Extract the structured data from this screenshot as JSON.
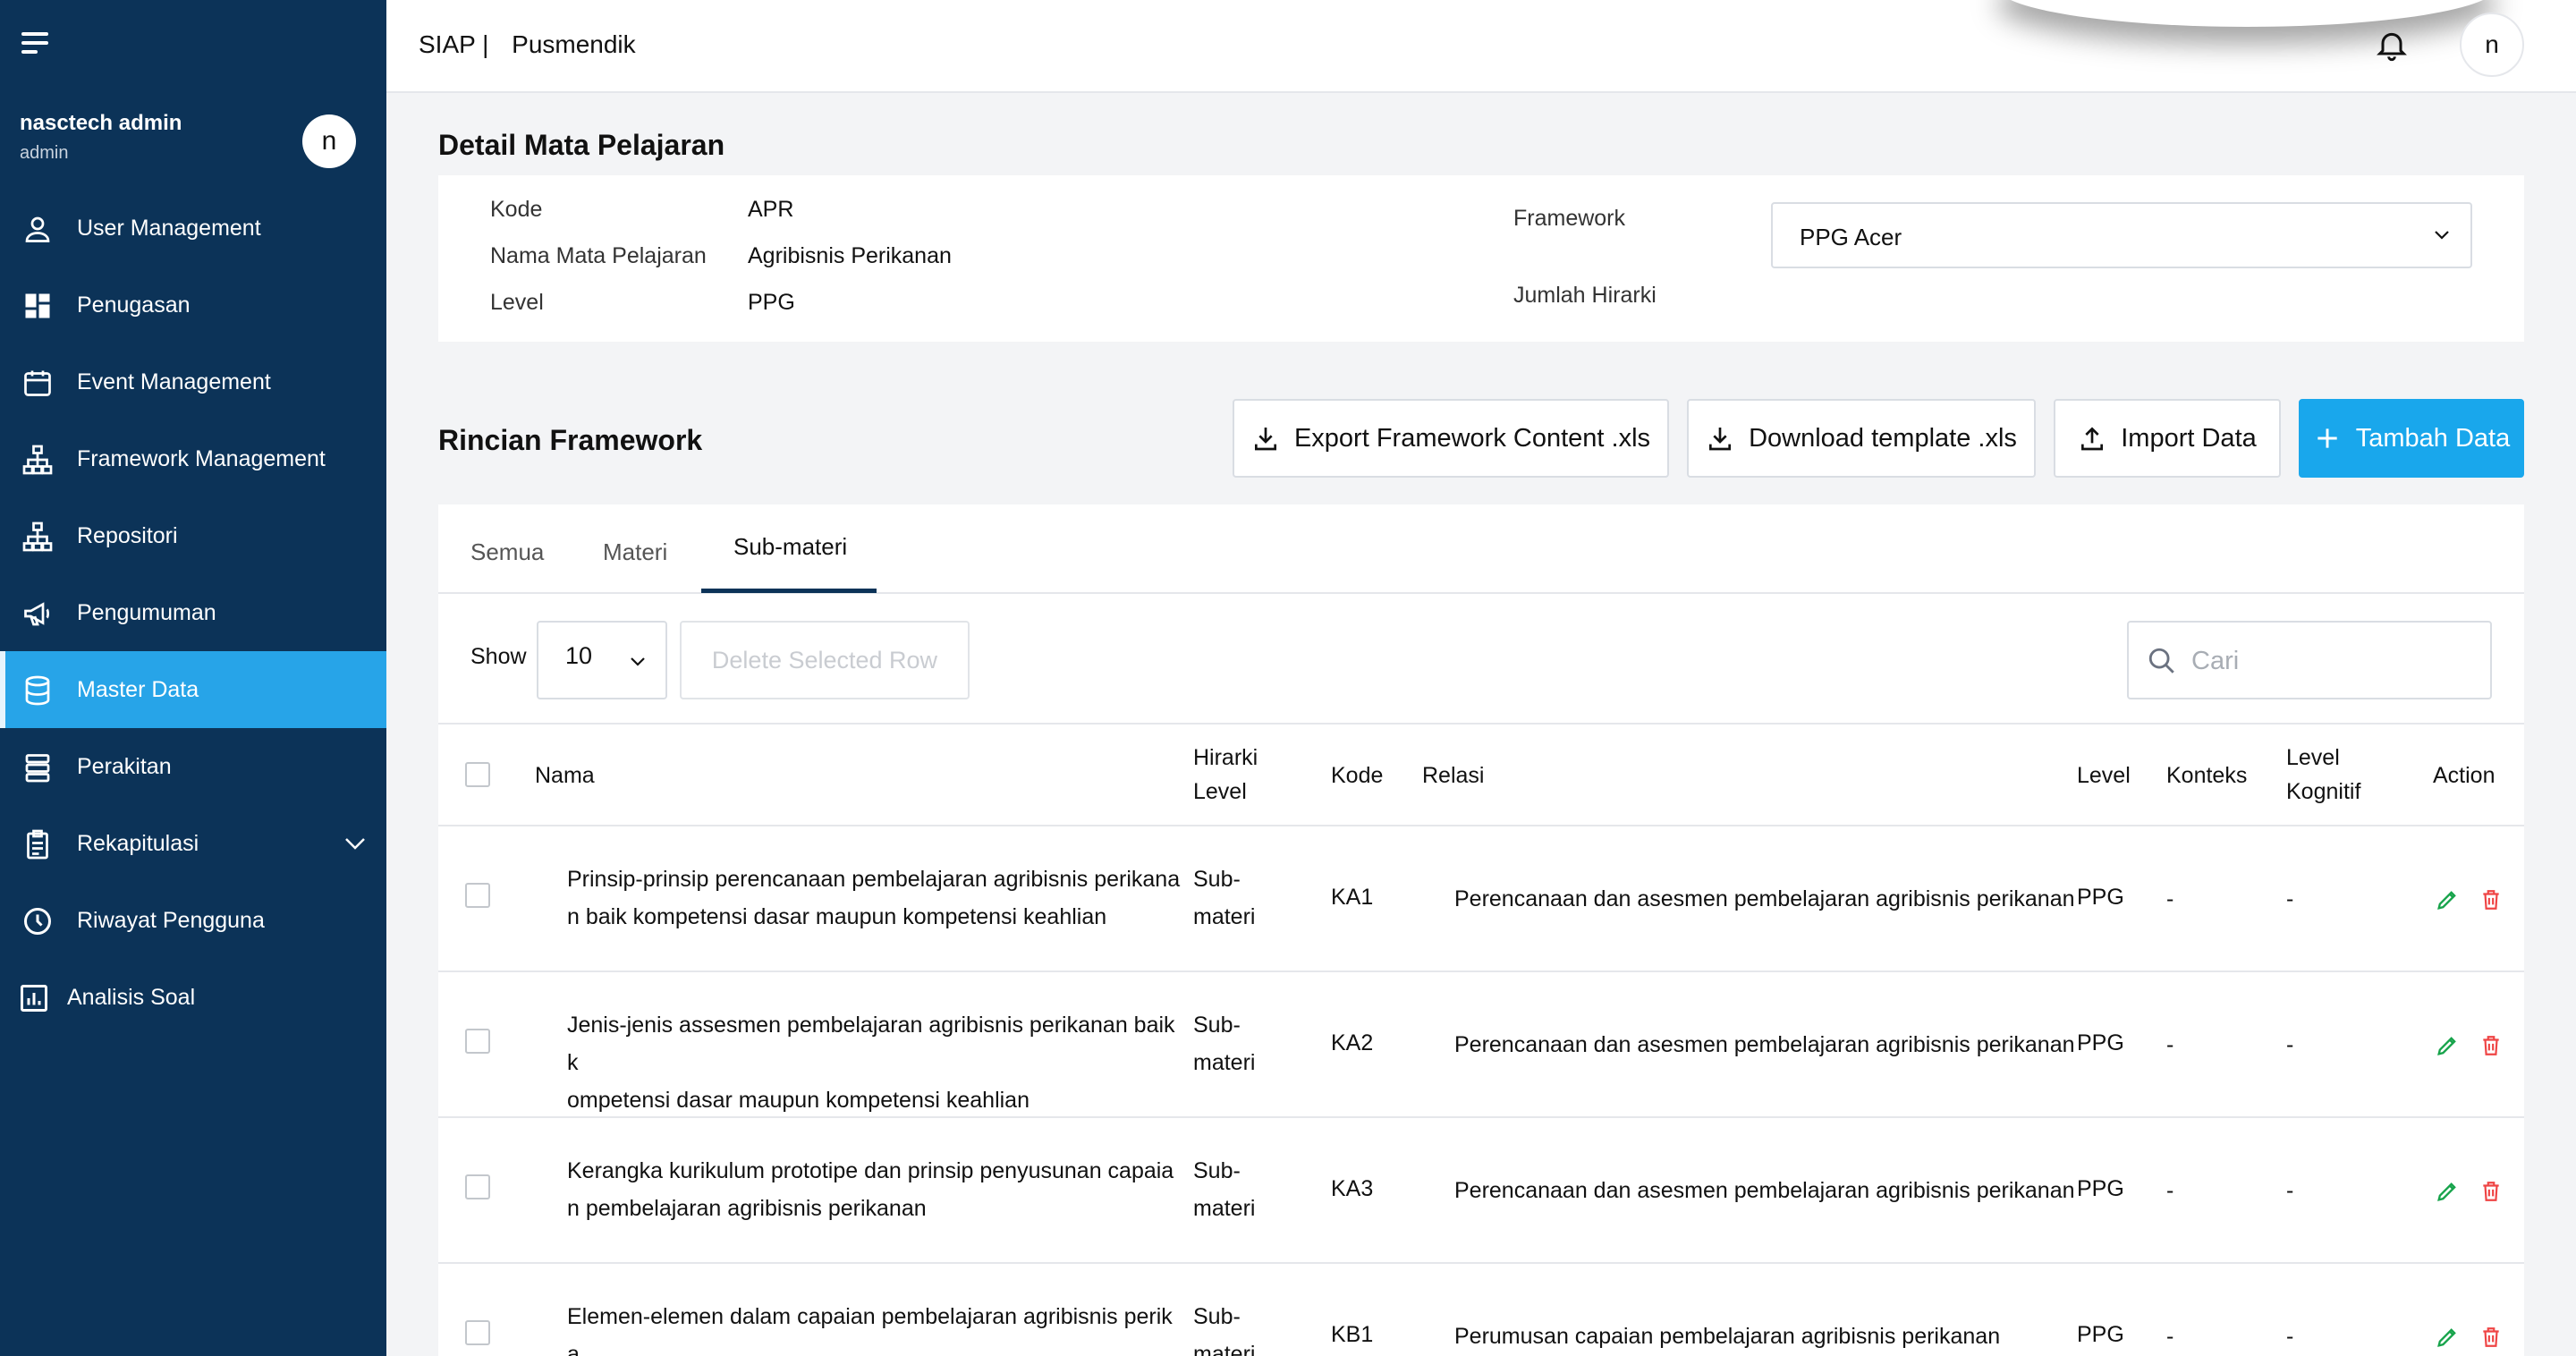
{
  "user": {
    "name": "nasctech admin",
    "role": "admin",
    "avatar_initial": "n"
  },
  "sidebar": {
    "items": [
      {
        "label": "User Management",
        "icon": "user-icon"
      },
      {
        "label": "Penugasan",
        "icon": "dashboard-icon"
      },
      {
        "label": "Event Management",
        "icon": "calendar-icon"
      },
      {
        "label": "Framework Management",
        "icon": "hierarchy-icon"
      },
      {
        "label": "Repositori",
        "icon": "hierarchy-icon"
      },
      {
        "label": "Pengumuman",
        "icon": "megaphone-icon"
      },
      {
        "label": "Master Data",
        "icon": "database-icon",
        "active": true
      },
      {
        "label": "Perakitan",
        "icon": "stack-icon"
      },
      {
        "label": "Rekapitulasi",
        "icon": "clipboard-icon",
        "expandable": true
      },
      {
        "label": "Riwayat Pengguna",
        "icon": "clock-icon"
      },
      {
        "label": "Analisis Soal",
        "icon": "chart-icon"
      }
    ]
  },
  "topbar": {
    "brand": "SIAP |",
    "org": "Pusmendik",
    "avatar_initial": "n"
  },
  "detail": {
    "title": "Detail Mata Pelajaran",
    "kode_label": "Kode",
    "kode_value": "APR",
    "nama_label": "Nama Mata Pelajaran",
    "nama_value": "Agribisnis Perikanan",
    "level_label": "Level",
    "level_value": "PPG",
    "framework_label": "Framework",
    "framework_value": "PPG Acer",
    "hirarki_label": "Jumlah Hirarki"
  },
  "framework": {
    "title": "Rincian Framework",
    "export_label": "Export Framework Content .xls",
    "download_label": "Download template .xls",
    "import_label": "Import Data",
    "add_label": "Tambah Data"
  },
  "tabs": [
    {
      "label": "Semua"
    },
    {
      "label": "Materi"
    },
    {
      "label": "Sub-materi",
      "active": true
    }
  ],
  "table_controls": {
    "show_label": "Show",
    "show_value": "10",
    "delete_label": "Delete Selected Row",
    "search_placeholder": "Cari"
  },
  "table": {
    "headers": {
      "nama": "Nama",
      "hirarki_1": "Hirarki",
      "hirarki_2": "Level",
      "kode": "Kode",
      "relasi": "Relasi",
      "level": "Level",
      "konteks": "Konteks",
      "kognitif_1": "Level",
      "kognitif_2": "Kognitif",
      "action": "Action"
    },
    "rows": [
      {
        "nama_1": "Prinsip-prinsip perencanaan pembelajaran agribisnis perikana",
        "nama_2": "n baik kompetensi dasar maupun kompetensi keahlian",
        "hirarki_1": "Sub-",
        "hirarki_2": "materi",
        "kode": "KA1",
        "relasi": "Perencanaan dan asesmen pembelajaran agribisnis perikanan",
        "level": "PPG",
        "konteks": "-",
        "kognitif": "-"
      },
      {
        "nama_1": "Jenis-jenis assesmen pembelajaran agribisnis perikanan baik k",
        "nama_2": "ompetensi dasar maupun kompetensi keahlian",
        "hirarki_1": "Sub-",
        "hirarki_2": "materi",
        "kode": "KA2",
        "relasi": "Perencanaan dan asesmen pembelajaran agribisnis perikanan",
        "level": "PPG",
        "konteks": "-",
        "kognitif": "-"
      },
      {
        "nama_1": "Kerangka kurikulum prototipe dan prinsip penyusunan capaia",
        "nama_2": "n pembelajaran agribisnis perikanan",
        "hirarki_1": "Sub-",
        "hirarki_2": "materi",
        "kode": "KA3",
        "relasi": "Perencanaan dan asesmen pembelajaran agribisnis perikanan",
        "level": "PPG",
        "konteks": "-",
        "kognitif": "-"
      },
      {
        "nama_1": "Elemen-elemen dalam capaian pembelajaran agribisnis perika",
        "nama_2": "nan",
        "hirarki_1": "Sub-",
        "hirarki_2": "materi",
        "kode": "KB1",
        "relasi": "Perumusan capaian pembelajaran agribisnis perikanan",
        "level": "PPG",
        "konteks": "-",
        "kognitif": "-"
      }
    ]
  },
  "colors": {
    "sidebar": "#0c3358",
    "active": "#27a4e8",
    "primary": "#19a7ec",
    "edit": "#16a34a",
    "delete": "#ef4444"
  }
}
